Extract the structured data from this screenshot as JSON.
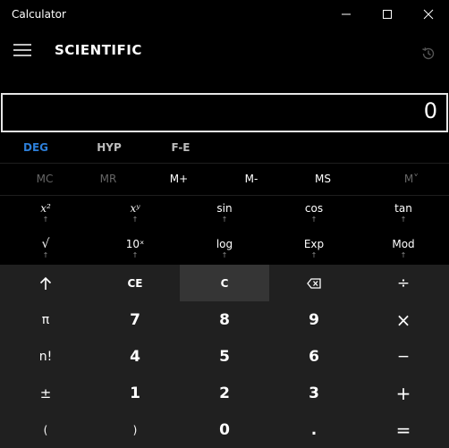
{
  "window": {
    "title": "Calculator"
  },
  "header": {
    "mode": "SCIENTIFIC"
  },
  "display": {
    "value": "0"
  },
  "angle_row": {
    "deg": "DEG",
    "hyp": "HYP",
    "fe": "F-E"
  },
  "memory": {
    "mc": "MC",
    "mr": "MR",
    "mplus": "M+",
    "mminus": "M-",
    "ms": "MS",
    "mlist": "M˅"
  },
  "functions": {
    "x2": "x²",
    "xy": "xʸ",
    "sin": "sin",
    "cos": "cos",
    "tan": "tan",
    "sqrt": "√",
    "ten_x": "10ˣ",
    "log": "log",
    "exp": "Exp",
    "mod": "Mod",
    "arrow": "↑"
  },
  "keys": {
    "shift": "↑",
    "ce": "CE",
    "c": "C",
    "back": "⌫",
    "divide": "÷",
    "pi": "π",
    "seven": "7",
    "eight": "8",
    "nine": "9",
    "multiply": "×",
    "fact": "n!",
    "four": "4",
    "five": "5",
    "six": "6",
    "minus": "−",
    "negate": "±",
    "one": "1",
    "two": "2",
    "three": "3",
    "plus": "+",
    "lparen": "(",
    "rparen": ")",
    "zero": "0",
    "dot": ".",
    "equals": "="
  },
  "colors": {
    "accent": "#2d7fd9",
    "disabled": "#666666",
    "keypad": "#202020",
    "pressed": "#353535"
  }
}
